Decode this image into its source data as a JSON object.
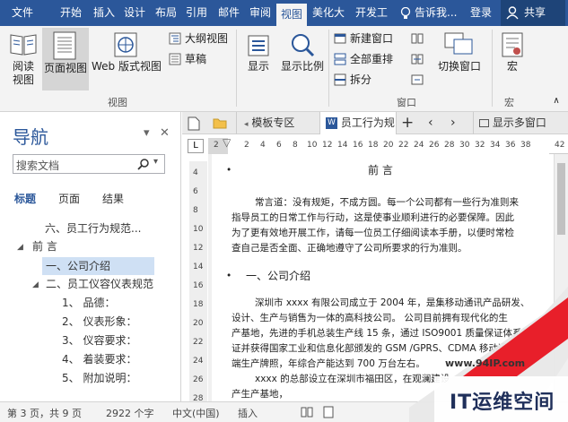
{
  "menubar": {
    "items": [
      "文件",
      "开始",
      "插入",
      "设计",
      "布局",
      "引用",
      "邮件",
      "审阅",
      "视图",
      "美化大",
      "开发工"
    ],
    "tell_me": "告诉我...",
    "login": "登录",
    "share": "共享"
  },
  "ribbon": {
    "read_view": "阅读\n视图",
    "page_view": "页面视图",
    "web_view": "Web 版式视图",
    "outline": "大纲视图",
    "draft": "草稿",
    "group_view": "视图",
    "show": "显示",
    "zoom": "显示比例",
    "new_window": "新建窗口",
    "arrange_all": "全部重排",
    "split": "拆分",
    "switch_window": "切换窗口",
    "group_window": "窗口",
    "macro": "宏",
    "group_macro": "宏"
  },
  "nav": {
    "title": "导航",
    "search_placeholder": "搜索文档",
    "tabs": [
      "标题",
      "页面",
      "结果"
    ],
    "tree": [
      {
        "label": "六、员工行为规范..."
      },
      {
        "label": "前 言"
      },
      {
        "label": "一、公司介绍"
      },
      {
        "label": "二、员工仪容仪表规范"
      },
      {
        "label": "1、 品德："
      },
      {
        "label": "2、 仪表形象："
      },
      {
        "label": "3、 仪容要求："
      },
      {
        "label": "4、 着装要求："
      },
      {
        "label": "5、 附加说明："
      }
    ]
  },
  "doctabs": {
    "tab1": "模板专区",
    "tab2": "员工行为规",
    "multi": "显示多窗口"
  },
  "ruler": {
    "h": [
      "2",
      "2",
      "4",
      "6",
      "8",
      "10",
      "12",
      "14",
      "16",
      "18",
      "20",
      "22",
      "24",
      "26",
      "28",
      "30",
      "32",
      "34",
      "36",
      "38",
      "42"
    ],
    "v": [
      "4",
      "6",
      "8",
      "10",
      "12",
      "14",
      "16",
      "18",
      "20",
      "22",
      "24",
      "26",
      "28"
    ]
  },
  "document": {
    "heading": "前 言",
    "p1": [
      "常言道：没有规矩，不成方圆。每一个公司都有一些行为准则来",
      "指导员工的日常工作与行动，这是使事业顺利进行的必要保障。因此",
      "为了更有效地开展工作，请每一位员工仔细阅读本手册，以便时常检",
      "查自己是否全面、正确地遵守了公司所要求的行为准则。"
    ],
    "section1": "一、公司介绍",
    "p2": [
      "深圳市 xxxx 有限公司成立于 2004 年，是集移动通讯产品研发、",
      "设计、生产与销售为一体的高科技公司。 公司目前拥有现代化的生",
      "产基地，先进的手机总装生产线 15 条，通过 ISO9001 质量保证体系认",
      "证并获得国家工业和信息化部颁发的 GSM /GPRS、CDMA 移动通",
      "端生产牌照，年综合产能达到 700 万台左右。",
      "xxxx 的总部设立在深圳市福田区，在观澜建设",
      "产生产基地，"
    ]
  },
  "status": {
    "page": "第 3 页，共 9 页",
    "words": "2922 个字",
    "lang": "中文(中国)",
    "mode": "插入"
  },
  "watermark": {
    "url": "www.94IP.com",
    "brand": "IT运维空间"
  }
}
